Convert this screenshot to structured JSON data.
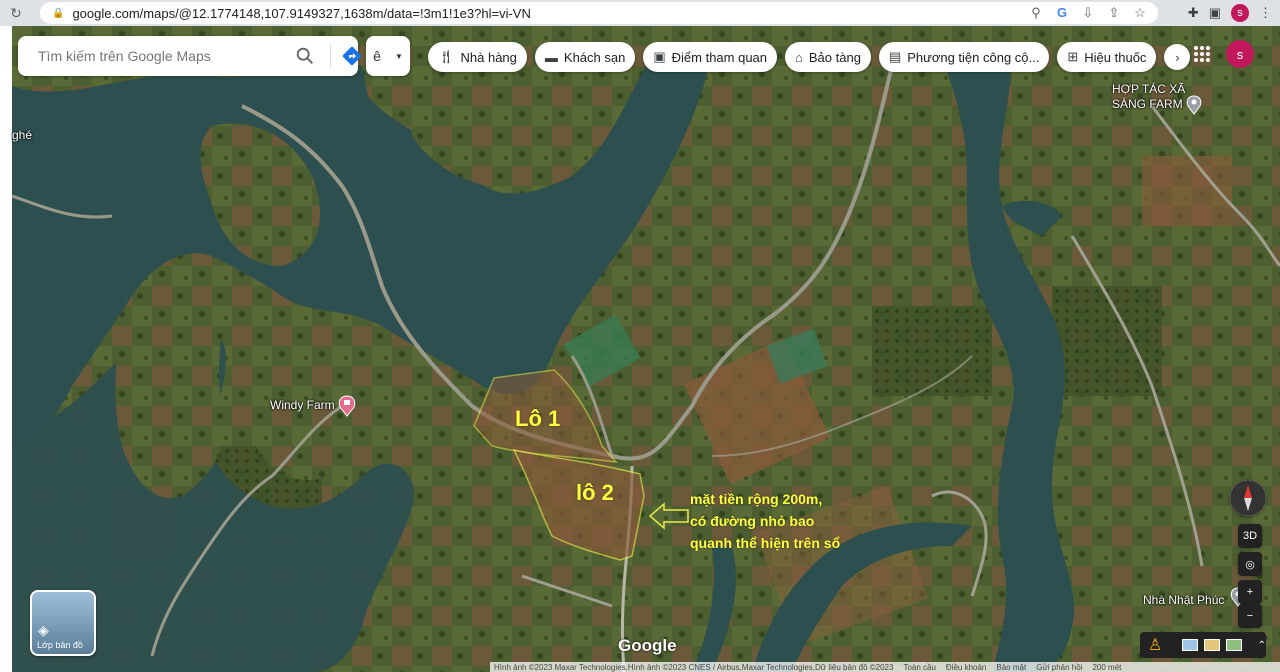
{
  "browser": {
    "url": "google.com/maps/@12.1774148,107.9149327,1638m/data=!3m1!1e3?hl=vi-VN",
    "profile_initial": "s"
  },
  "search": {
    "placeholder": "Tìm kiếm trên Google Maps",
    "ime_label": "ê"
  },
  "chips": [
    {
      "icon": "restaurant-icon",
      "label": "Nhà hàng"
    },
    {
      "icon": "hotel-icon",
      "label": "Khách sạn"
    },
    {
      "icon": "camera-icon",
      "label": "Điểm tham quan"
    },
    {
      "icon": "museum-icon",
      "label": "Bảo tàng"
    },
    {
      "icon": "transit-icon",
      "label": "Phương tiện công cộ..."
    },
    {
      "icon": "pharmacy-icon",
      "label": "Hiệu thuốc"
    }
  ],
  "user": {
    "avatar_initial": "s"
  },
  "map_labels": {
    "coop": "HỢP TÁC XÃ\nSÁNG FARM",
    "windy_farm": "Windy Farm",
    "nha_nhat_phuc": "Nhà Nhật Phúc",
    "edge_left": "ghé"
  },
  "lots": {
    "lot1": "Lô 1",
    "lot2": "lô 2"
  },
  "annotation": [
    "mặt tiền rộng 200m,",
    "có đường nhỏ bao",
    "quanh thể hiện trên sổ"
  ],
  "controls": {
    "layers_label": "Lớp bản đồ",
    "three_d": "3D",
    "zoom_in": "+",
    "zoom_out": "−"
  },
  "footer": {
    "google": "Google",
    "imagery": "Hình ảnh ©2023 Maxar Technologies,Hình ảnh ©2023 CNES / Airbus,Maxar Technologies,Dữ liệu bản đồ ©2023",
    "links": [
      "Toàn cầu",
      "Điều khoản",
      "Bảo mật",
      "Gửi phản hồi"
    ],
    "scale": "200 mét"
  },
  "colors": {
    "lot_outline": "#e8e84a",
    "annotation_text": "#ffff3c",
    "water": "#2e4f4f"
  }
}
